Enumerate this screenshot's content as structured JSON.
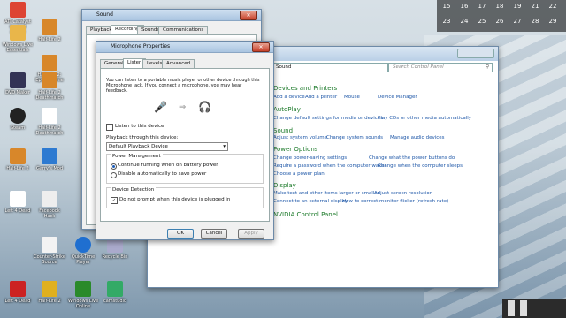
{
  "calendar": {
    "row1": [
      "15",
      "16",
      "17",
      "18",
      "19"
    ],
    "row1b": [
      "16",
      "17",
      "21",
      "22"
    ],
    "row2": [
      "23",
      "24",
      "25",
      "26",
      "27",
      "28",
      "29"
    ]
  },
  "desktop_icons": [
    {
      "label": "ATI Catalyst Control Center",
      "color": "#d43"
    },
    {
      "label": "Half-Life 2",
      "color": "#d8872a"
    },
    {
      "label": "Windows Live Essentials",
      "color": "#e9b64a"
    },
    {
      "label": "Half-Life 2: Episode One",
      "color": "#d8872a"
    },
    {
      "label": "DVD Maker",
      "color": "#335"
    },
    {
      "label": "Half-Life 2 Deathmatch",
      "color": "#d8872a"
    },
    {
      "label": "Steam",
      "color": "#222"
    },
    {
      "label": "Half-Life 2 Deathmatch",
      "color": "#fff"
    },
    {
      "label": "Half-Life 2",
      "color": "#d8872a"
    },
    {
      "label": "Garry's Mod",
      "color": "#2d7ad1"
    },
    {
      "label": "Left 4 Dead",
      "color": "#fff"
    },
    {
      "label": "Facebook Hack",
      "color": "#eee"
    },
    {
      "label": "Counter-Strike Source",
      "color": "#f3f3f3"
    },
    {
      "label": "QuickTime Player",
      "color": "#1f6fd0"
    },
    {
      "label": "Recycle Bin",
      "color": "#aac"
    },
    {
      "label": "Left 4 Dead",
      "color": "#c22"
    },
    {
      "label": "Half-Life 2",
      "color": "#e0b020"
    },
    {
      "label": "Windows Live Online",
      "color": "#2a8a2a"
    },
    {
      "label": "camstudio",
      "color": "#3a6"
    }
  ],
  "sound_window": {
    "title": "Sound",
    "tabs": [
      "Playback",
      "Recording",
      "Sounds",
      "Communications"
    ],
    "active_tab": "Recording"
  },
  "mic_dialog": {
    "title": "Microphone Properties",
    "tabs": [
      "General",
      "Listen",
      "Levels",
      "Advanced"
    ],
    "active_tab": "Listen",
    "description": "You can listen to a portable music player or other device through this Microphone jack. If you connect a microphone, you may hear feedback.",
    "listen_checkbox": "Listen to this device",
    "playback_label": "Playback through this device:",
    "playback_value": "Default Playback Device",
    "power_group": "Power Management",
    "power_opt1": "Continue running when on battery power",
    "power_opt2": "Disable automatically to save power",
    "detection_group": "Device Detection",
    "detection_checkbox": "Do not prompt when this device is plugged in",
    "ok": "OK",
    "cancel": "Cancel",
    "apply": "Apply"
  },
  "control_panel": {
    "breadcrumb": "Sound",
    "search_placeholder": "Search Control Panel",
    "sections": [
      {
        "head": "Devices and Printers",
        "links": [
          "Add a device",
          "Add a printer",
          "Mouse",
          "Device Manager"
        ]
      },
      {
        "head": "AutoPlay",
        "links": [
          "Change default settings for media or devices",
          "Play CDs or other media automatically"
        ]
      },
      {
        "head": "Sound",
        "links": [
          "Adjust system volume",
          "Change system sounds",
          "Manage audio devices"
        ]
      },
      {
        "head": "Power Options",
        "links": [
          "Change power-saving settings",
          "Change what the power buttons do",
          "Require a password when the computer wakes",
          "Change when the computer sleeps",
          "Choose a power plan"
        ]
      },
      {
        "head": "Display",
        "links": [
          "Make text and other items larger or smaller",
          "Adjust screen resolution",
          "Connect to an external display",
          "How to correct monitor flicker (refresh rate)"
        ]
      },
      {
        "head": "NVIDIA Control Panel",
        "links": []
      }
    ]
  }
}
